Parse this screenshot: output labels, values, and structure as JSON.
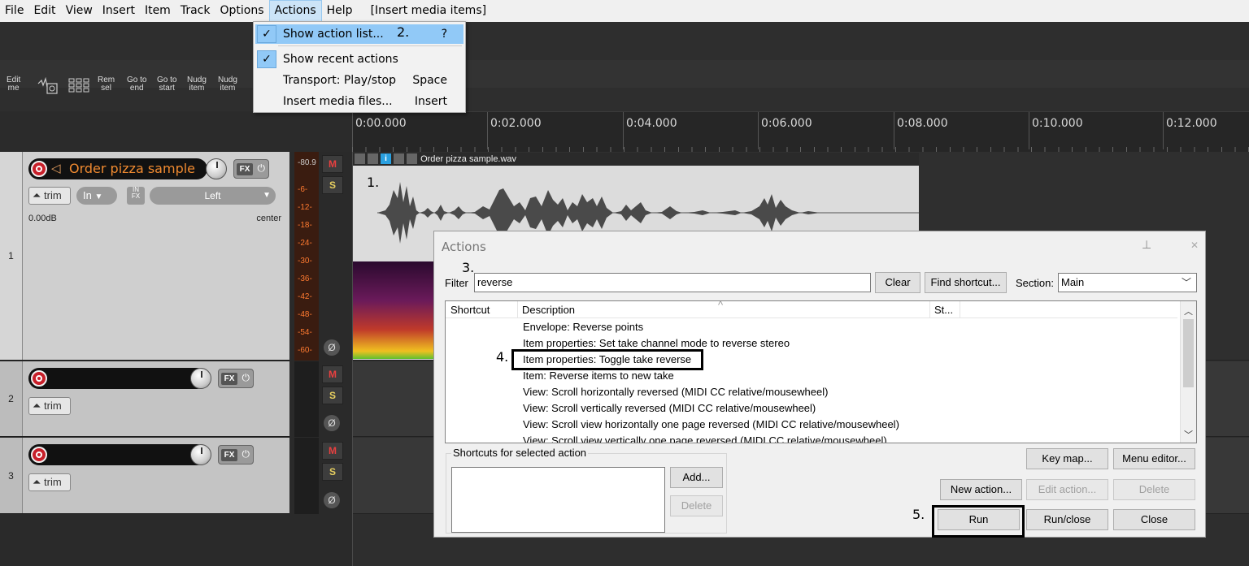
{
  "menu": {
    "items": [
      "File",
      "Edit",
      "View",
      "Insert",
      "Item",
      "Track",
      "Options",
      "Actions",
      "Help"
    ],
    "extra": "[Insert media items]"
  },
  "toolbar": {
    "buttons": [
      {
        "l1": "Edit",
        "l2": "me"
      },
      {
        "l1": "Rem",
        "l2": "sel"
      },
      {
        "l1": "Go to",
        "l2": "end"
      },
      {
        "l1": "Go to",
        "l2": "start"
      },
      {
        "l1": "Nudg",
        "l2": "item"
      },
      {
        "l1": "Nudg",
        "l2": "item"
      }
    ]
  },
  "actions_menu": {
    "items": [
      {
        "label": "Show action list...",
        "key": "?",
        "checked": true
      },
      {
        "label": "Show recent actions",
        "key": "",
        "checked": true
      },
      {
        "label": "Transport: Play/stop",
        "key": "Space",
        "checked": false
      },
      {
        "label": "Insert media files...",
        "key": "Insert",
        "checked": false
      }
    ]
  },
  "annotations": [
    "1.",
    "2.",
    "3.",
    "4.",
    "5."
  ],
  "ruler": [
    "0:00.000",
    "0:02.000",
    "0:04.000",
    "0:06.000",
    "0:08.000",
    "0:10.000",
    "0:12.000"
  ],
  "tracks": [
    {
      "num": "1",
      "name": "Order pizza sample",
      "trim": "trim",
      "in": "In",
      "infx": "IN\nFX",
      "pan": "Left",
      "vol": "0.00dB",
      "panlabel": "center"
    },
    {
      "num": "2",
      "trim": "trim"
    },
    {
      "num": "3",
      "trim": "trim"
    }
  ],
  "meter": {
    "peak": "-80.9",
    "labels": [
      "-6-",
      "-12-",
      "-18-",
      "-24-",
      "-30-",
      "-36-",
      "-42-",
      "-48-",
      "-54-",
      "-60-"
    ]
  },
  "mute_label": "M",
  "solo_label": "S",
  "fx_label": "FX",
  "phase_label": "Ø",
  "item": {
    "name": "Order pizza sample.wav"
  },
  "dialog": {
    "title": "Actions",
    "filter_label": "Filter",
    "filter_value": "reverse",
    "clear": "Clear",
    "find_shortcut": "Find shortcut...",
    "section_label": "Section:",
    "section_value": "Main",
    "col_shortcut": "Shortcut",
    "col_description": "Description",
    "col_state": "St...",
    "rows": [
      "Envelope: Reverse points",
      "Item properties: Set take channel mode to reverse stereo",
      "Item properties: Toggle take reverse",
      "Item: Reverse items to new take",
      "View: Scroll horizontally reversed (MIDI CC relative/mousewheel)",
      "View: Scroll vertically reversed (MIDI CC relative/mousewheel)",
      "View: Scroll view horizontally one page reversed (MIDI CC relative/mousewheel)",
      "View: Scroll view vertically one page reversed (MIDI CC relative/mousewheel)"
    ],
    "shortcuts_group": "Shortcuts for selected action",
    "add": "Add...",
    "delete_shortcut": "Delete",
    "key_map": "Key map...",
    "menu_editor": "Menu editor...",
    "new_action": "New action...",
    "edit_action": "Edit action...",
    "delete_action": "Delete",
    "run": "Run",
    "run_close": "Run/close",
    "close": "Close"
  }
}
